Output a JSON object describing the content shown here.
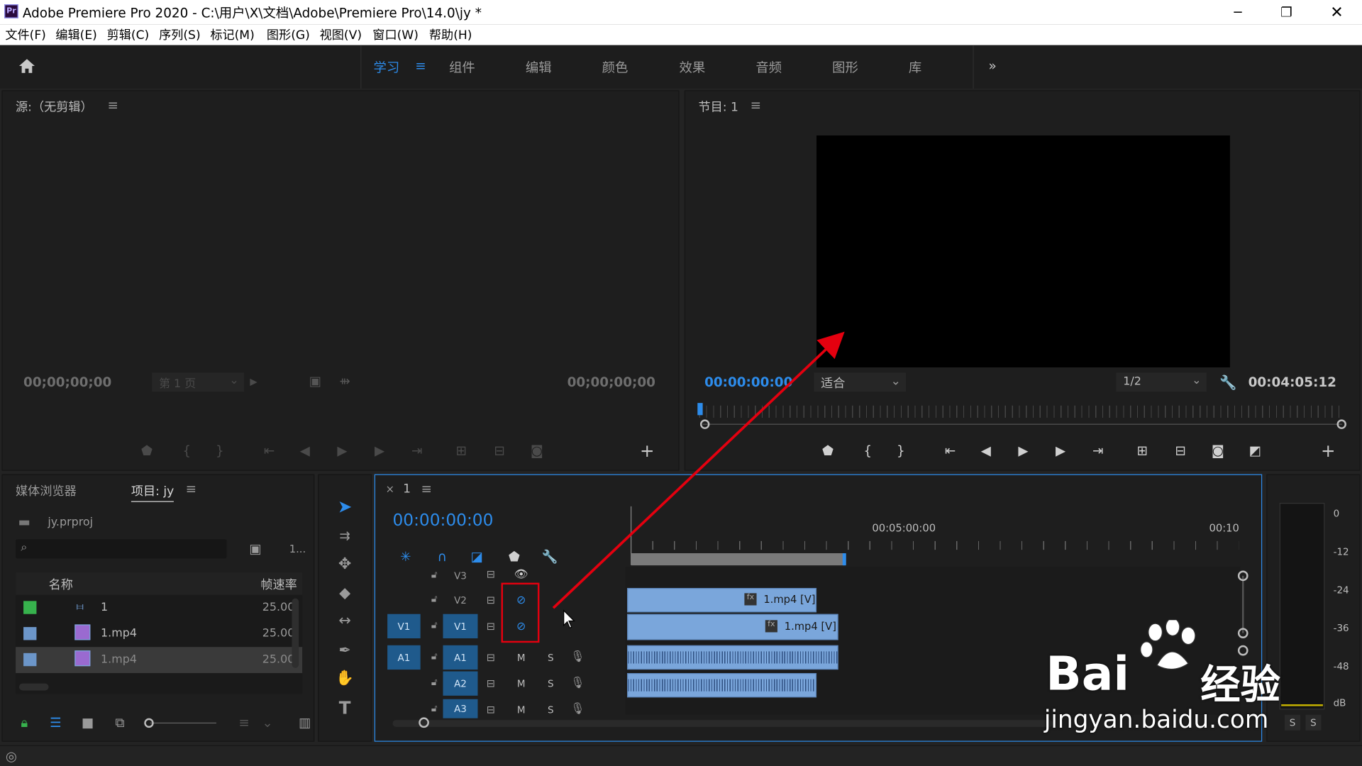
{
  "titlebar": {
    "title": "Adobe Premiere Pro 2020 - C:\\用户\\X\\文档\\Adobe\\Premiere Pro\\14.0\\jy *",
    "app_badge": "Pr"
  },
  "menu": [
    "文件(F)",
    "编辑(E)",
    "剪辑(C)",
    "序列(S)",
    "标记(M)",
    "图形(G)",
    "视图(V)",
    "窗口(W)",
    "帮助(H)"
  ],
  "workspaces": [
    "学习",
    "组件",
    "编辑",
    "颜色",
    "效果",
    "音频",
    "图形",
    "库"
  ],
  "workspace_active": "学习",
  "source": {
    "title": "源:（无剪辑）",
    "tc_left": "00;00;00;00",
    "tc_right": "00;00;00;00",
    "page": "第 1 页"
  },
  "program": {
    "title": "节目: 1",
    "timecode": "00:00:00:00",
    "fit": "适合",
    "resolution": "1/2",
    "duration": "00:04:05:12"
  },
  "project": {
    "tab_media": "媒体浏览器",
    "tab_project": "项目: jy",
    "file": "jy.prproj",
    "count": "1...",
    "col_name": "名称",
    "col_rate": "帧速率",
    "items": [
      {
        "name": "1",
        "rate": "25.00",
        "color": "#37b24d"
      },
      {
        "name": "1.mp4",
        "rate": "25.00",
        "color": "#6c96c9"
      },
      {
        "name": "1.mp4",
        "rate": "25.00",
        "color": "#6c96c9"
      }
    ]
  },
  "timeline": {
    "seq": "1",
    "timecode": "00:00:00:00",
    "ruler": [
      "00:05:00:00",
      "00:10"
    ],
    "video_tracks": [
      "V3",
      "V2",
      "V1"
    ],
    "audio_tracks": [
      "A1",
      "A2",
      "A3"
    ],
    "src_v": "V1",
    "src_a": "A1",
    "mute": "M",
    "solo": "S",
    "clip_v2": "1.mp4 [V]",
    "clip_v1": "1.mp4 [V]",
    "fx": "fx"
  },
  "meter": {
    "labels": [
      "0",
      "-12",
      "-24",
      "-36",
      "-48",
      "dB"
    ],
    "solo": "S"
  },
  "watermark": {
    "brand_a": "Bai",
    "brand_b": "经验",
    "url": "jingyan.baidu.com"
  },
  "colors": {
    "accent": "#2d8ceb",
    "highlight_box": "#e4000f",
    "arrow": "#e4000f",
    "clip": "#7aa6db"
  }
}
